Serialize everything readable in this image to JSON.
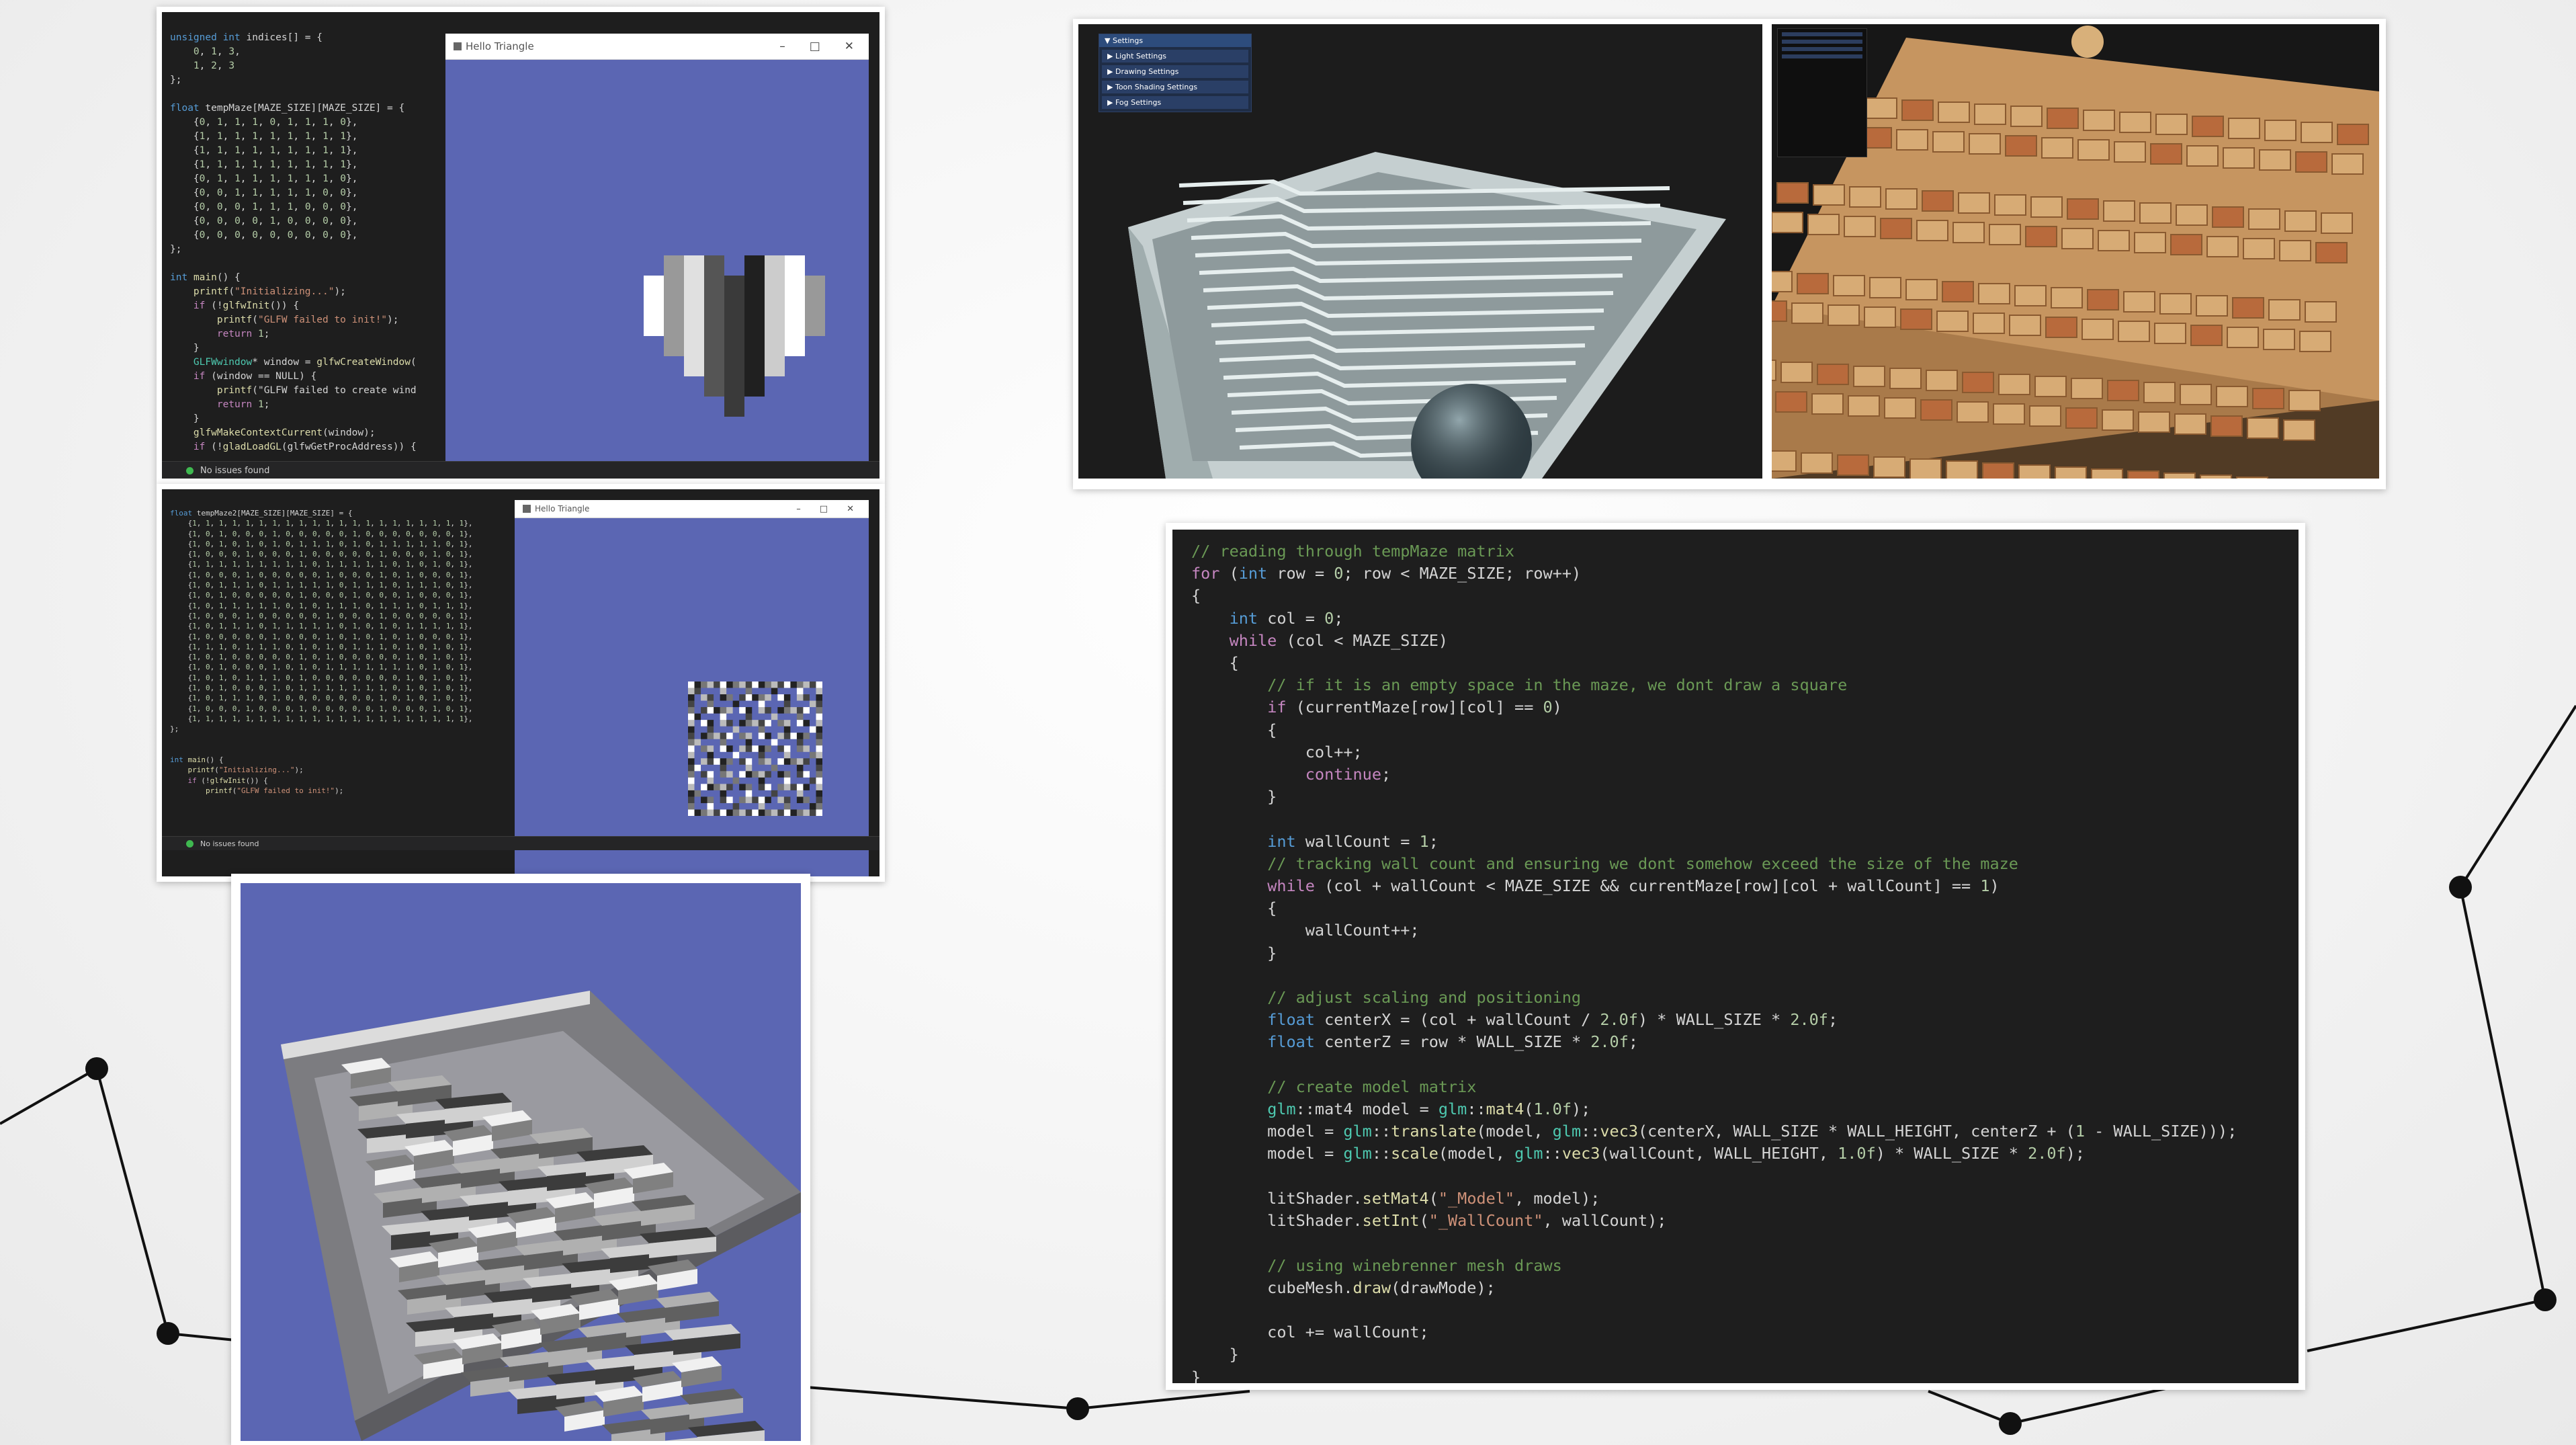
{
  "palette": {
    "gl_background": "#5b66b3",
    "editor_background": "#1e1e1e",
    "connector_color": "#111111"
  },
  "ide_top": {
    "code_lines": [
      "unsigned int indices[] = {",
      "    0, 1, 3,",
      "    1, 2, 3",
      "};",
      "",
      "float tempMaze[MAZE_SIZE][MAZE_SIZE] = {",
      "    {0, 1, 1, 1, 0, 1, 1, 1, 0},",
      "    {1, 1, 1, 1, 1, 1, 1, 1, 1},",
      "    {1, 1, 1, 1, 1, 1, 1, 1, 1},",
      "    {1, 1, 1, 1, 1, 1, 1, 1, 1},",
      "    {0, 1, 1, 1, 1, 1, 1, 1, 0},",
      "    {0, 0, 1, 1, 1, 1, 1, 0, 0},",
      "    {0, 0, 0, 1, 1, 1, 0, 0, 0},",
      "    {0, 0, 0, 0, 1, 0, 0, 0, 0},",
      "    {0, 0, 0, 0, 0, 0, 0, 0, 0},",
      "};",
      "",
      "int main() {",
      "    printf(\"Initializing...\");",
      "    if (!glfwInit()) {",
      "        printf(\"GLFW failed to init!\");",
      "        return 1;",
      "    }",
      "    GLFWwindow* window = glfwCreateWindow(",
      "    if (window == NULL) {",
      "        printf(\"GLFW failed to create wind",
      "        return 1;",
      "    }",
      "    glfwMakeContextCurrent(window);",
      "    if (!gladLoadGL(glfwGetProcAddress)) {"
    ],
    "status": "No issues found",
    "window_title": "Hello Triangle"
  },
  "ide_bottom": {
    "code_lines": [
      "float tempMaze2[MAZE_SIZE][MAZE_SIZE] = {",
      "    {1, 1, 1, 1, 1, 1, 1, 1, 1, 1, 1, 1, 1, 1, 1, 1, 1, 1, 1, 1, 1},",
      "    {1, 0, 1, 0, 0, 0, 1, 0, 0, 0, 0, 0, 1, 0, 0, 0, 0, 0, 0, 0, 1},",
      "    {1, 0, 1, 0, 1, 0, 1, 0, 1, 1, 1, 0, 1, 0, 1, 1, 1, 1, 1, 0, 1},",
      "    {1, 0, 0, 0, 1, 0, 0, 0, 1, 0, 0, 0, 0, 0, 1, 0, 0, 0, 1, 0, 1},",
      "    {1, 1, 1, 1, 1, 1, 1, 1, 1, 0, 1, 1, 1, 1, 1, 0, 1, 0, 1, 0, 1},",
      "    {1, 0, 0, 0, 1, 0, 0, 0, 0, 0, 1, 0, 0, 0, 1, 0, 1, 0, 0, 0, 1},",
      "    {1, 0, 1, 1, 1, 0, 1, 1, 1, 1, 1, 0, 1, 1, 1, 0, 1, 1, 1, 0, 1},",
      "    {1, 0, 1, 0, 0, 0, 0, 0, 1, 0, 0, 0, 1, 0, 0, 0, 1, 0, 0, 0, 1},",
      "    {1, 0, 1, 1, 1, 1, 1, 0, 1, 0, 1, 1, 1, 0, 1, 1, 1, 0, 1, 1, 1},",
      "    {1, 0, 0, 0, 1, 0, 0, 0, 0, 0, 1, 0, 0, 0, 1, 0, 0, 0, 0, 0, 1},",
      "    {1, 0, 1, 1, 1, 0, 1, 1, 1, 1, 1, 0, 1, 0, 1, 0, 1, 1, 1, 1, 1},",
      "    {1, 0, 0, 0, 0, 0, 1, 0, 0, 0, 1, 0, 1, 0, 1, 0, 1, 0, 0, 0, 1},",
      "    {1, 1, 1, 0, 1, 1, 1, 0, 1, 0, 1, 0, 1, 1, 1, 0, 1, 0, 1, 0, 1},",
      "    {1, 0, 1, 0, 0, 0, 0, 0, 1, 0, 1, 0, 0, 0, 0, 0, 1, 0, 1, 0, 1},",
      "    {1, 0, 1, 0, 0, 0, 1, 0, 1, 0, 1, 1, 1, 1, 1, 1, 1, 0, 1, 0, 1},",
      "    {1, 0, 1, 0, 1, 1, 1, 0, 1, 0, 0, 0, 0, 0, 0, 0, 1, 0, 1, 0, 1},",
      "    {1, 0, 1, 0, 0, 0, 1, 0, 1, 1, 1, 1, 1, 1, 1, 0, 1, 0, 1, 0, 1},",
      "    {1, 0, 1, 1, 1, 0, 1, 0, 0, 0, 0, 0, 0, 0, 1, 0, 1, 0, 1, 0, 1},",
      "    {1, 0, 0, 0, 1, 0, 0, 0, 1, 0, 0, 0, 0, 0, 1, 0, 0, 0, 1, 0, 1},",
      "    {1, 1, 1, 1, 1, 1, 1, 1, 1, 1, 1, 1, 1, 1, 1, 1, 1, 1, 1, 1, 1},",
      "};",
      "",
      "",
      "int main() {",
      "    printf(\"Initializing...\");",
      "    if (!glfwInit()) {",
      "        printf(\"GLFW failed to init!\");"
    ],
    "status": "No issues found",
    "window_title": "Hello Triangle"
  },
  "render_gray": {
    "settings_header": "Settings",
    "settings_items": [
      "Light Settings",
      "Drawing Settings",
      "Toon Shading Settings",
      "Fog Settings"
    ]
  },
  "code_big": {
    "lines": [
      "// reading through tempMaze matrix",
      "for (int row = 0; row < MAZE_SIZE; row++)",
      "{",
      "    int col = 0;",
      "    while (col < MAZE_SIZE)",
      "    {",
      "        // if it is an empty space in the maze, we dont draw a square",
      "        if (currentMaze[row][col] == 0)",
      "        {",
      "            col++;",
      "            continue;",
      "        }",
      "",
      "        int wallCount = 1;",
      "        // tracking wall count and ensuring we dont somehow exceed the size of the maze",
      "        while (col + wallCount < MAZE_SIZE && currentMaze[row][col + wallCount] == 1)",
      "        {",
      "            wallCount++;",
      "        }",
      "",
      "        // adjust scaling and positioning",
      "        float centerX = (col + wallCount / 2.0f) * WALL_SIZE * 2.0f;",
      "        float centerZ = row * WALL_SIZE * 2.0f;",
      "",
      "        // create model matrix",
      "        glm::mat4 model = glm::mat4(1.0f);",
      "        model = glm::translate(model, glm::vec3(centerX, WALL_SIZE * WALL_HEIGHT, centerZ + (1 - WALL_SIZE)));",
      "        model = glm::scale(model, glm::vec3(wallCount, WALL_HEIGHT, 1.0f) * WALL_SIZE * 2.0f);",
      "",
      "        litShader.setMat4(\"_Model\", model);",
      "        litShader.setInt(\"_WallCount\", wallCount);",
      "",
      "        // using winebrenner mesh draws",
      "        cubeMesh.draw(drawMode);",
      "",
      "        col += wallCount;",
      "    }",
      "}"
    ]
  }
}
